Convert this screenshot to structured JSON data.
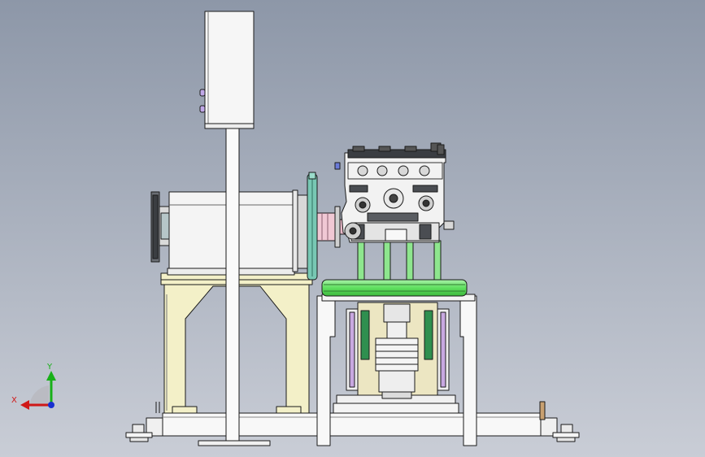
{
  "viewport": {
    "background_top": "#8d97a8",
    "background_bottom": "#c9cdd6"
  },
  "triad": {
    "x_label": "X",
    "y_label": "Y",
    "x_color": "#d01818",
    "y_color": "#18b018",
    "z_color": "#1830d0"
  },
  "colors": {
    "outline": "#1a1a1a",
    "body_white": "#f4f4f4",
    "stand_cream": "#f3f0c8",
    "frame_white": "#f8f8f8",
    "turntable_green": "#5fe05f",
    "pillar_green": "#8ee68e",
    "flywheel_teal": "#78c8b4",
    "mount_lilac": "#c8a8e0",
    "plate_tan": "#ece6c2",
    "engine_grey": "#6a6e74",
    "hub_pink": "#f0c8d4"
  }
}
